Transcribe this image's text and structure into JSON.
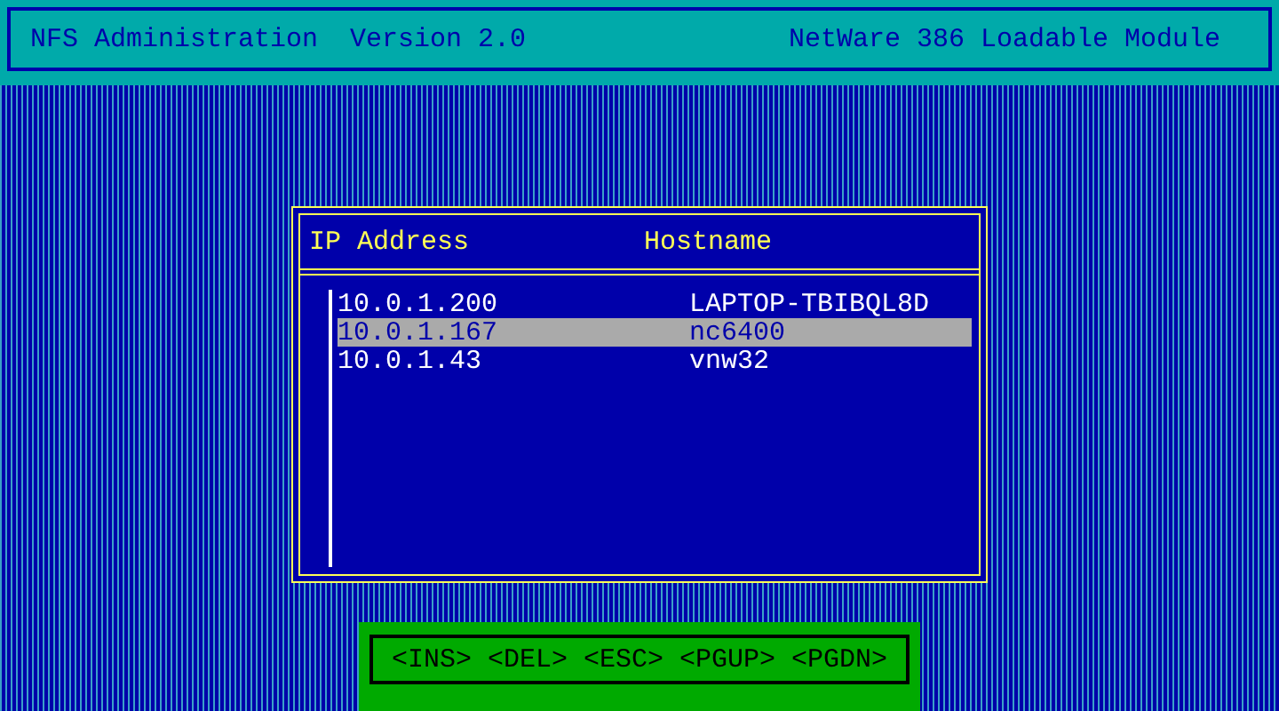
{
  "header": {
    "title": "NFS Administration  Version 2.0",
    "module": "NetWare 386 Loadable Module"
  },
  "table": {
    "columns": [
      "IP Address",
      "Hostname"
    ],
    "rows": [
      {
        "ip": "10.0.1.200",
        "hostname": "LAPTOP-TBIBQL8D",
        "selected": false
      },
      {
        "ip": "10.0.1.167",
        "hostname": "nc6400",
        "selected": true
      },
      {
        "ip": "10.0.1.43",
        "hostname": "vnw32",
        "selected": false
      }
    ]
  },
  "keys": [
    "<INS>",
    "<DEL>",
    "<ESC>",
    "<PGUP>",
    "<PGDN>"
  ]
}
